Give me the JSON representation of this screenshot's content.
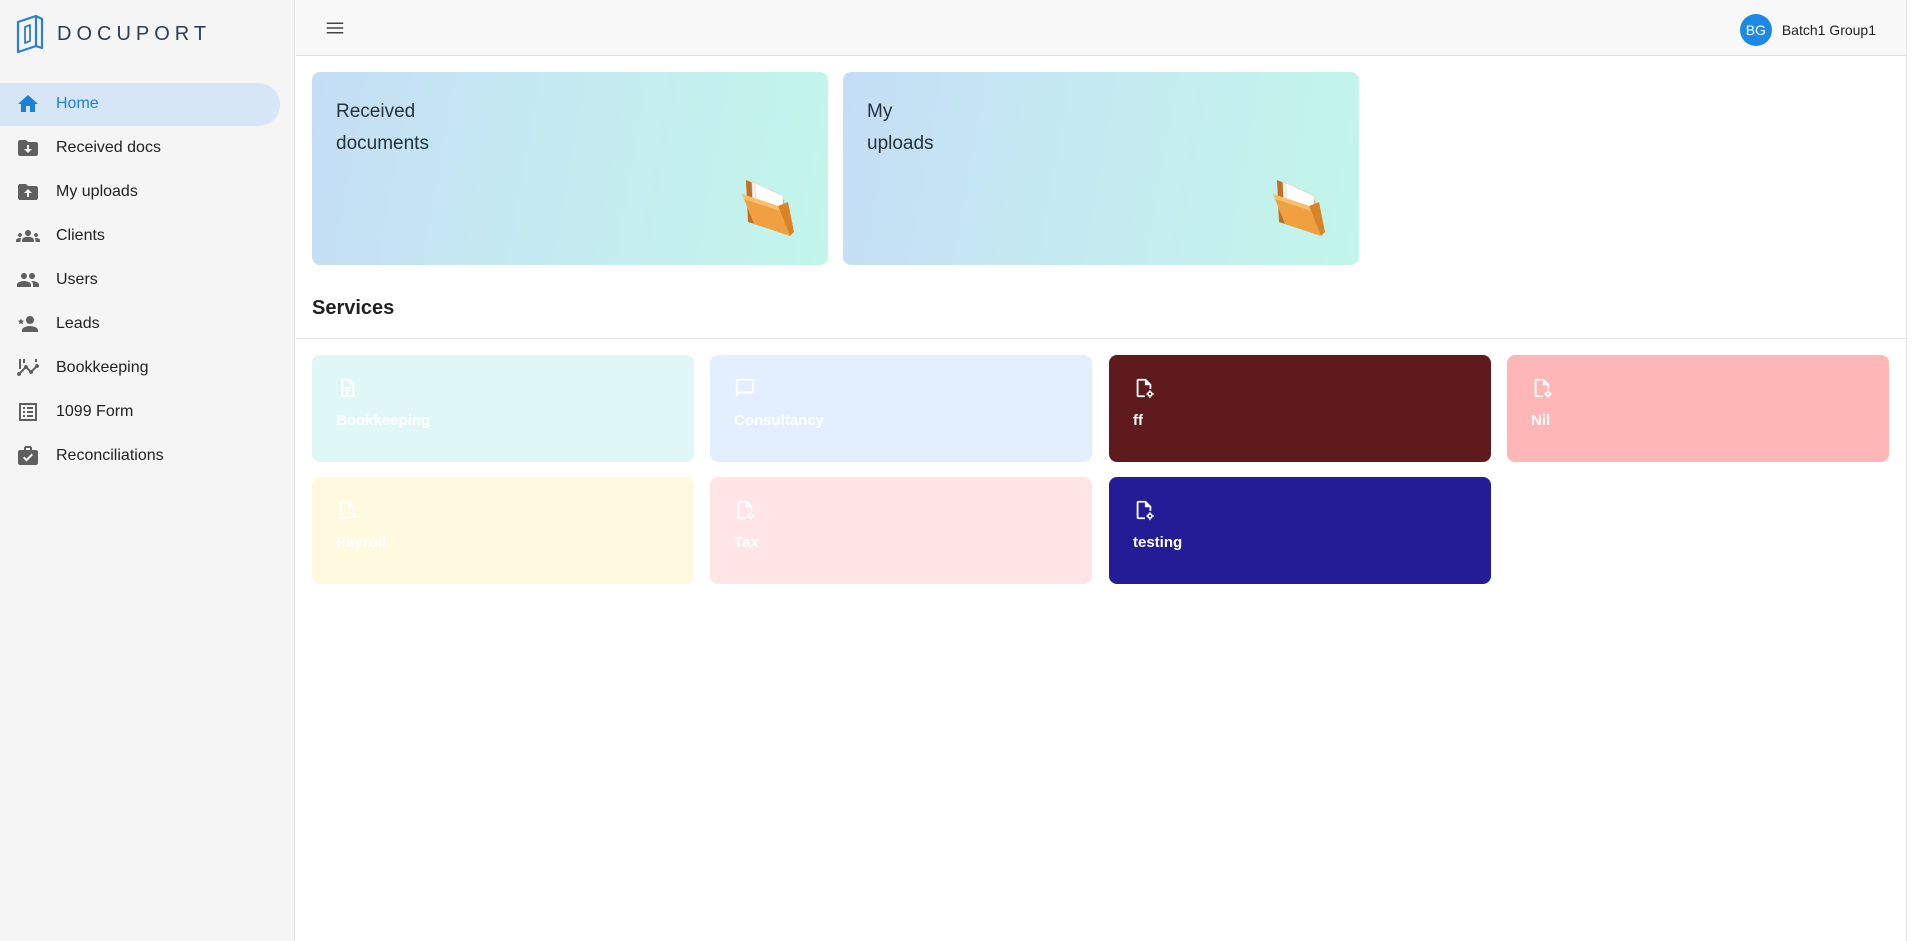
{
  "app": {
    "logo_text": "DOCUPORT"
  },
  "sidebar": {
    "items": [
      {
        "label": "Home",
        "icon": "home-icon",
        "active": true
      },
      {
        "label": "Received docs",
        "icon": "folder-download-icon"
      },
      {
        "label": "My uploads",
        "icon": "folder-upload-icon"
      },
      {
        "label": "Clients",
        "icon": "group-icon"
      },
      {
        "label": "Users",
        "icon": "people-icon"
      },
      {
        "label": "Leads",
        "icon": "person-star-icon"
      },
      {
        "label": "Bookkeeping",
        "icon": "chart-icon"
      },
      {
        "label": "1099 Form",
        "icon": "form-list-icon"
      },
      {
        "label": "Reconciliations",
        "icon": "briefcase-check-icon"
      }
    ]
  },
  "topbar": {
    "user": {
      "initials": "BG",
      "name": "Batch1 Group1"
    }
  },
  "cards": [
    {
      "line1": "Received",
      "line2": "documents"
    },
    {
      "line1": "My",
      "line2": "uploads"
    }
  ],
  "services": {
    "title": "Services",
    "items": [
      {
        "label": "Bookkeeping",
        "bg": "#e0f7f7",
        "fg": "#ffffff",
        "icon": "document-icon"
      },
      {
        "label": "Consultancy",
        "bg": "#e3efff",
        "fg": "#ffffff",
        "icon": "chat-icon"
      },
      {
        "label": "ff",
        "bg": "#5e1a1c",
        "fg": "#ffffff",
        "icon": "file-gear-icon"
      },
      {
        "label": "Nil",
        "bg": "#ffb6b6",
        "fg": "#ffffff",
        "icon": "file-gear-icon"
      },
      {
        "label": "Payroll",
        "bg": "#fff9e0",
        "fg": "#ffffff",
        "icon": "file-pay-icon"
      },
      {
        "label": "Tax",
        "bg": "#ffe5e6",
        "fg": "#ffffff",
        "icon": "file-gear-icon"
      },
      {
        "label": "testing",
        "bg": "#231c96",
        "fg": "#ffffff",
        "icon": "file-gear-icon"
      }
    ]
  }
}
